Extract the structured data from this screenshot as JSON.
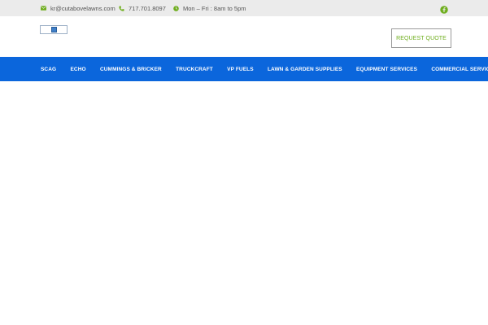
{
  "topbar": {
    "email": "kr@cutabovelawns.com",
    "phone": "717.701.8097",
    "hours": "Mon – Fri : 8am to 5pm",
    "social_icon": "facebook-icon",
    "icon_color": "#6fae1e"
  },
  "header": {
    "logo_icon": "broken-image-icon",
    "cta_label": "REQUEST QUOTE"
  },
  "nav": {
    "items": [
      {
        "label": "SCAG"
      },
      {
        "label": "ECHO"
      },
      {
        "label": "CUMMINGS & BRICKER"
      },
      {
        "label": "TRUCKCRAFT"
      },
      {
        "label": "VP FUELS"
      },
      {
        "label": "LAWN & GARDEN SUPPLIES"
      },
      {
        "label": "EQUIPMENT SERVICES"
      },
      {
        "label": "COMMERCIAL SERVICES"
      }
    ],
    "background": "#0b66dc"
  }
}
